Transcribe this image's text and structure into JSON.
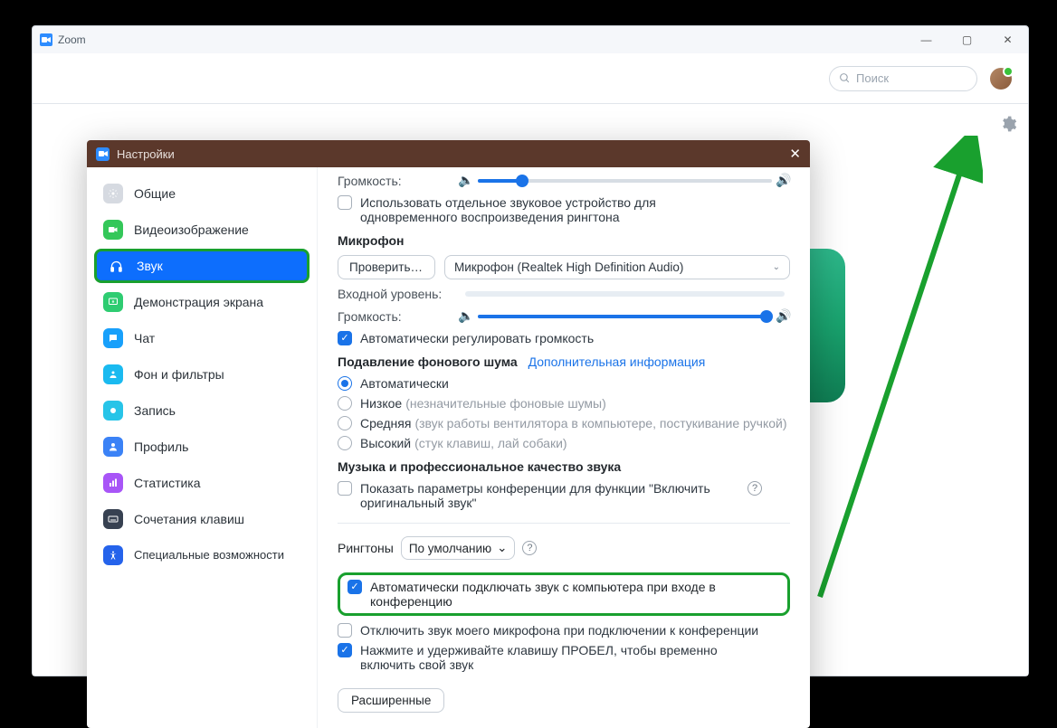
{
  "window": {
    "title": "Zoom"
  },
  "search": {
    "placeholder": "Поиск"
  },
  "dialog": {
    "title": "Настройки"
  },
  "sidebar": {
    "items": [
      {
        "label": "Общие"
      },
      {
        "label": "Видеоизображение"
      },
      {
        "label": "Звук"
      },
      {
        "label": "Демонстрация экрана"
      },
      {
        "label": "Чат"
      },
      {
        "label": "Фон и фильтры"
      },
      {
        "label": "Запись"
      },
      {
        "label": "Профиль"
      },
      {
        "label": "Статистика"
      },
      {
        "label": "Сочетания клавиш"
      },
      {
        "label": "Специальные возможности"
      }
    ]
  },
  "audio": {
    "volume_label_speaker": "Громкость:",
    "speaker_volume_pct": 15,
    "separate_device_label": "Использовать отдельное звуковое устройство для одновременного воспроизведения рингтона",
    "mic_heading": "Микрофон",
    "test_mic_label": "Проверить м...",
    "mic_device": "Микрофон (Realtek High Definition Audio)",
    "input_level_label": "Входной уровень:",
    "volume_label_mic": "Громкость:",
    "mic_volume_pct": 98,
    "auto_adjust_label": "Автоматически регулировать громкость",
    "noise_heading": "Подавление фонового шума",
    "noise_link": "Дополнительная информация",
    "noise_options": {
      "auto": "Автоматически",
      "low": "Низкое",
      "low_sub": "(незначительные фоновые шумы)",
      "medium": "Средняя",
      "medium_sub": "(звук работы вентилятора в компьютере, постукивание ручкой)",
      "high": "Высокий",
      "high_sub": "(стук клавиш, лай собаки)"
    },
    "music_heading": "Музыка и профессиональное качество звука",
    "show_original_label": "Показать параметры конференции для функции \"Включить оригинальный звук\"",
    "ringtones_label": "Рингтоны",
    "ringtones_value": "По умолчанию",
    "auto_join_label": "Автоматически подключать звук с компьютера при входе в конференцию",
    "mute_on_join_label": "Отключить звук моего микрофона при подключении к конференции",
    "space_unmute_label": "Нажмите и удерживайте клавишу ПРОБЕЛ, чтобы временно включить свой звук",
    "advanced_label": "Расширенные"
  }
}
